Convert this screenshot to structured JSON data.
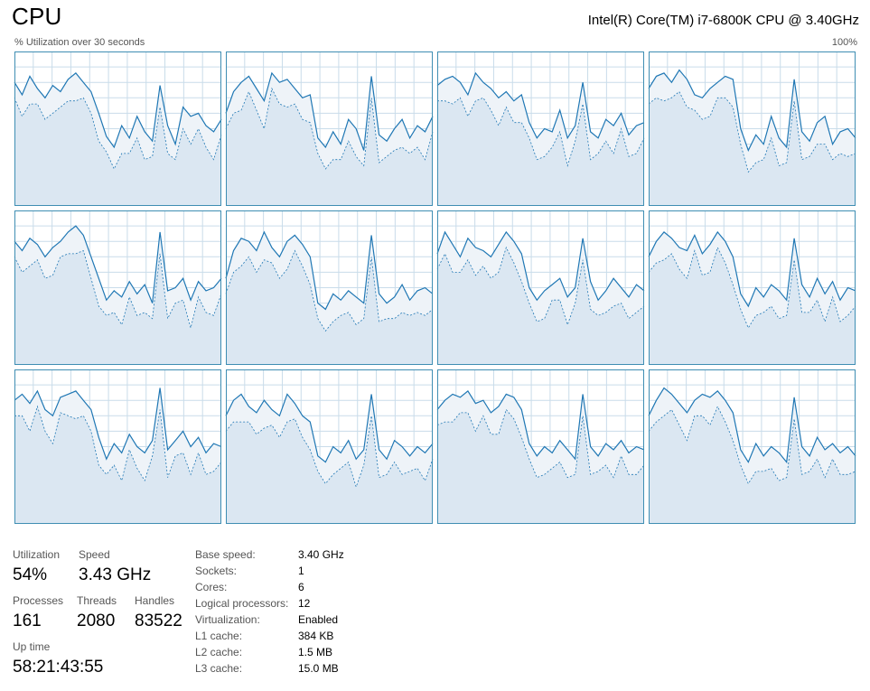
{
  "header": {
    "title": "CPU",
    "cpu_name": "Intel(R) Core(TM) i7-6800K CPU @ 3.40GHz",
    "graph_caption": "% Utilization over 30 seconds",
    "graph_max": "100%"
  },
  "colors": {
    "line": "#1f77b4",
    "fill": "#dbe7f2",
    "kernel_fill": "#eef3f8",
    "border": "#3f8eb3",
    "grid": "#c9dcea"
  },
  "chart_data": [
    {
      "type": "area",
      "name": "",
      "y": [
        80,
        72,
        84,
        76,
        70,
        78,
        74,
        82,
        86,
        80,
        74,
        60,
        45,
        38,
        52,
        44,
        58,
        48,
        42,
        78,
        52,
        40,
        64,
        58,
        60,
        52,
        48,
        56
      ],
      "ylim": [
        0,
        100
      ]
    },
    {
      "type": "area",
      "name": "",
      "y": [
        60,
        74,
        80,
        84,
        76,
        68,
        86,
        80,
        82,
        76,
        70,
        72,
        44,
        38,
        48,
        40,
        56,
        50,
        36,
        84,
        46,
        42,
        50,
        56,
        44,
        52,
        48,
        58
      ],
      "ylim": [
        0,
        100
      ]
    },
    {
      "type": "area",
      "name": "",
      "y": [
        78,
        82,
        84,
        80,
        72,
        86,
        80,
        76,
        70,
        74,
        68,
        72,
        54,
        44,
        50,
        48,
        62,
        44,
        52,
        80,
        48,
        44,
        56,
        52,
        60,
        46,
        52,
        54
      ],
      "ylim": [
        0,
        100
      ]
    },
    {
      "type": "area",
      "name": "",
      "y": [
        76,
        84,
        86,
        80,
        88,
        82,
        72,
        70,
        76,
        80,
        84,
        82,
        50,
        36,
        46,
        40,
        58,
        44,
        38,
        82,
        48,
        42,
        54,
        58,
        40,
        48,
        50,
        44
      ],
      "ylim": [
        0,
        100
      ]
    },
    {
      "type": "area",
      "name": "",
      "y": [
        80,
        74,
        82,
        78,
        70,
        76,
        80,
        86,
        90,
        84,
        70,
        56,
        42,
        48,
        44,
        54,
        46,
        52,
        40,
        86,
        48,
        50,
        56,
        42,
        54,
        48,
        50,
        56
      ],
      "ylim": [
        0,
        100
      ]
    },
    {
      "type": "area",
      "name": "",
      "y": [
        56,
        74,
        82,
        80,
        74,
        86,
        76,
        70,
        80,
        84,
        78,
        70,
        40,
        36,
        46,
        42,
        48,
        44,
        40,
        84,
        46,
        40,
        44,
        52,
        42,
        48,
        50,
        46
      ],
      "ylim": [
        0,
        100
      ]
    },
    {
      "type": "area",
      "name": "",
      "y": [
        72,
        86,
        78,
        70,
        82,
        76,
        74,
        70,
        78,
        86,
        80,
        72,
        50,
        42,
        48,
        52,
        56,
        44,
        50,
        82,
        54,
        42,
        48,
        56,
        50,
        44,
        52,
        48
      ],
      "ylim": [
        0,
        100
      ]
    },
    {
      "type": "area",
      "name": "",
      "y": [
        70,
        80,
        86,
        82,
        76,
        74,
        84,
        72,
        78,
        86,
        80,
        70,
        46,
        38,
        50,
        44,
        52,
        48,
        42,
        82,
        52,
        44,
        56,
        46,
        54,
        42,
        50,
        48
      ],
      "ylim": [
        0,
        100
      ]
    },
    {
      "type": "area",
      "name": "",
      "y": [
        80,
        84,
        78,
        86,
        74,
        70,
        82,
        84,
        86,
        80,
        74,
        56,
        42,
        52,
        46,
        58,
        50,
        46,
        54,
        88,
        48,
        54,
        60,
        50,
        56,
        46,
        52,
        50
      ],
      "ylim": [
        0,
        100
      ]
    },
    {
      "type": "area",
      "name": "",
      "y": [
        70,
        80,
        84,
        76,
        72,
        80,
        74,
        70,
        84,
        78,
        70,
        66,
        44,
        40,
        50,
        46,
        54,
        42,
        48,
        84,
        48,
        42,
        54,
        50,
        44,
        50,
        46,
        52
      ],
      "ylim": [
        0,
        100
      ]
    },
    {
      "type": "area",
      "name": "",
      "y": [
        74,
        80,
        84,
        82,
        86,
        78,
        80,
        72,
        76,
        84,
        82,
        74,
        52,
        44,
        50,
        46,
        54,
        48,
        42,
        84,
        50,
        44,
        52,
        48,
        54,
        46,
        50,
        48
      ],
      "ylim": [
        0,
        100
      ]
    },
    {
      "type": "area",
      "name": "",
      "y": [
        70,
        80,
        88,
        84,
        78,
        72,
        80,
        84,
        82,
        86,
        80,
        72,
        48,
        40,
        52,
        44,
        50,
        46,
        40,
        82,
        50,
        44,
        56,
        48,
        52,
        46,
        50,
        44
      ],
      "ylim": [
        0,
        100
      ]
    }
  ],
  "stats": {
    "utilization": {
      "label": "Utilization",
      "value": "54%"
    },
    "speed": {
      "label": "Speed",
      "value": "3.43 GHz"
    },
    "processes": {
      "label": "Processes",
      "value": "161"
    },
    "threads": {
      "label": "Threads",
      "value": "2080"
    },
    "handles": {
      "label": "Handles",
      "value": "83522"
    },
    "uptime": {
      "label": "Up time",
      "value": "58:21:43:55"
    }
  },
  "details": [
    {
      "label": "Base speed:",
      "value": "3.40 GHz"
    },
    {
      "label": "Sockets:",
      "value": "1"
    },
    {
      "label": "Cores:",
      "value": "6"
    },
    {
      "label": "Logical processors:",
      "value": "12"
    },
    {
      "label": "Virtualization:",
      "value": "Enabled"
    },
    {
      "label": "L1 cache:",
      "value": "384 KB"
    },
    {
      "label": "L2 cache:",
      "value": "1.5 MB"
    },
    {
      "label": "L3 cache:",
      "value": "15.0 MB"
    }
  ]
}
